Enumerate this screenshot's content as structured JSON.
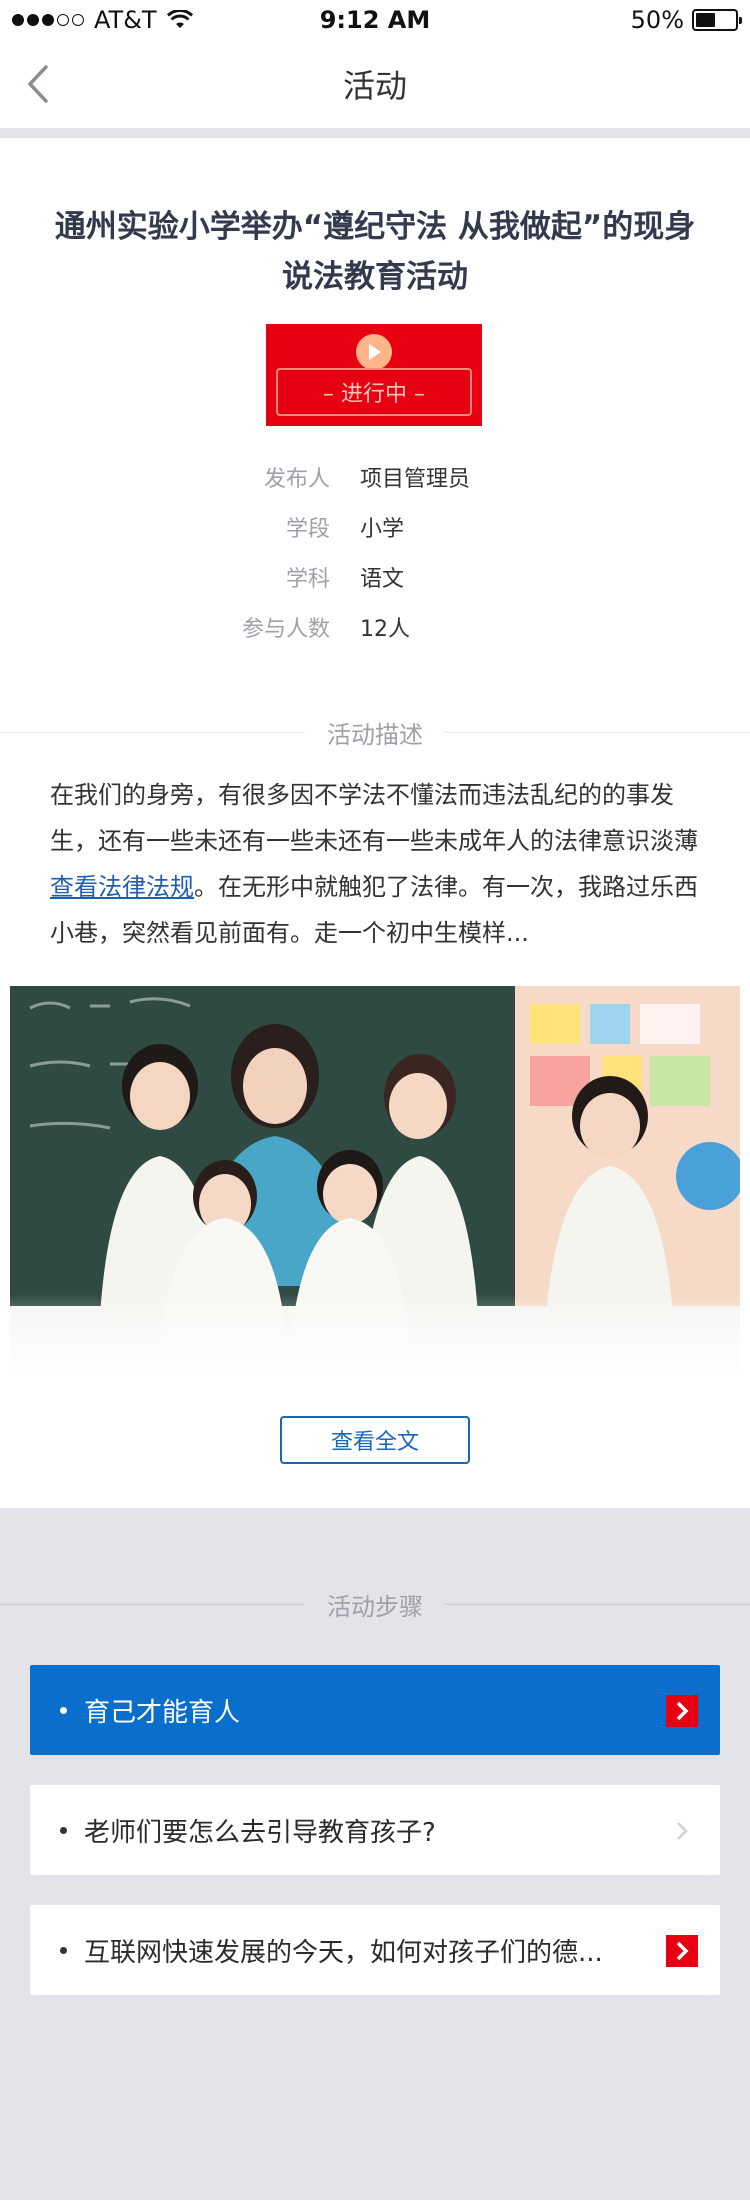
{
  "status_bar": {
    "carrier": "AT&T",
    "time": "9:12 AM",
    "battery": "50%",
    "battery_level": 0.5
  },
  "navbar": {
    "title": "活动",
    "back_icon": "chevron-left-icon"
  },
  "activity": {
    "title": "通州实验小学举办“遵纪守法 从我做起”的现身说法教育活动",
    "status": "– 进行中 –",
    "info": [
      {
        "key": "发布人",
        "value": "项目管理员"
      },
      {
        "key": "学段",
        "value": "小学"
      },
      {
        "key": "学科",
        "value": "语文"
      },
      {
        "key": "参与人数",
        "value": "12人"
      }
    ]
  },
  "description": {
    "heading": "活动描述",
    "text_before": "在我们的身旁，有很多因不学法不懂法而违法乱纪的的事发生，还有一些未还有一些未还有一些未成年人的法律意识淡薄",
    "link": "查看法律法规",
    "text_after": "。在无形中就触犯了法律。有一次，我路过乐西小巷，突然看见前面有。走一个初中生模样...",
    "more_button": "查看全文"
  },
  "steps": {
    "heading": "活动步骤",
    "items": [
      {
        "label": "育己才能育人",
        "active": true,
        "arrow": "red"
      },
      {
        "label": "老师们要怎么去引导教育孩子?",
        "active": false,
        "arrow": "plain"
      },
      {
        "label": "互联网快速发展的今天，如何对孩子们的德...",
        "active": false,
        "arrow": "red"
      }
    ]
  },
  "colors": {
    "primary": "#0a6fcc",
    "live_red": "#e60012",
    "link": "#1f5fb3",
    "background": "#e2e4e9"
  }
}
